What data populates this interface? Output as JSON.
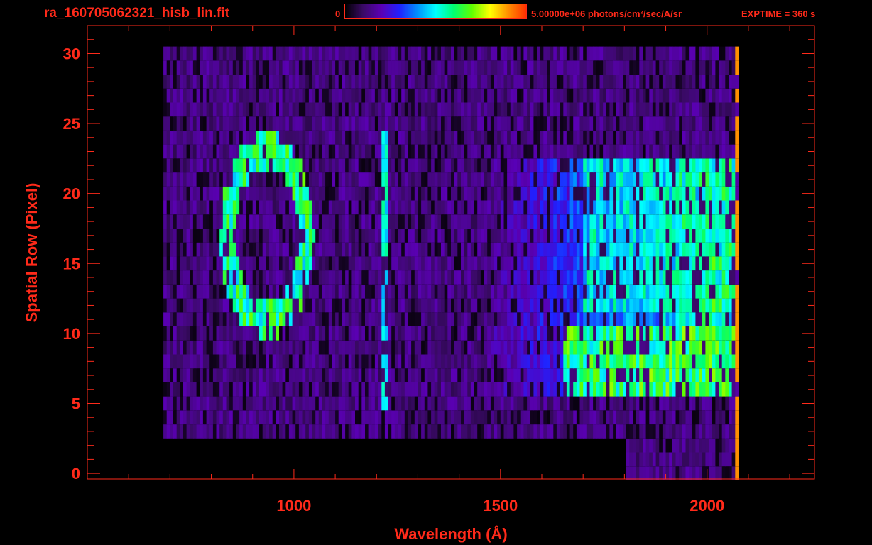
{
  "header": {
    "file_title": "ra_160705062321_hisb_lin.fit",
    "colorbar_min": "0",
    "colorbar_max": "5.00000e+06 photons/cm²/sec/A/sr",
    "exptime": "EXPTIME = 360 s"
  },
  "colors": {
    "text_and_axes": "#ff2a1a",
    "background": "#000000",
    "colormap": [
      "#000000",
      "#3a0a66",
      "#5a00b4",
      "#2020ff",
      "#0090ff",
      "#00ffff",
      "#00ff70",
      "#60ff00",
      "#ffff00",
      "#ff9000",
      "#ff3000"
    ]
  },
  "chart_data": {
    "type": "heatmap",
    "title": "ra_160705062321_hisb_lin.fit",
    "xlabel": "Wavelength (Å)",
    "ylabel": "Spatial Row (Pixel)",
    "xlim": [
      500,
      2260
    ],
    "ylim": [
      -0.4,
      32
    ],
    "xticks": [
      1000,
      1500,
      2000
    ],
    "yticks": [
      0,
      5,
      10,
      15,
      20,
      25,
      30
    ],
    "grid": false,
    "colorbar": {
      "min": 0,
      "max": 5000000,
      "units": "photons/cm²/sec/A/sr"
    },
    "rows": [
      0,
      30
    ],
    "data_extent_wavelength": [
      680,
      2075
    ],
    "features": [
      {
        "name": "bright band",
        "rows": [
          6,
          10
        ],
        "wavelength": [
          1650,
          2060
        ],
        "level": 0.62
      },
      {
        "name": "bright band",
        "rows": [
          12,
          22
        ],
        "wavelength": [
          1700,
          2060
        ],
        "level": 0.5
      },
      {
        "name": "vertical line",
        "wavelength": 1216,
        "rows": [
          5,
          24
        ],
        "level": 0.5
      },
      {
        "name": "ring",
        "center_wavelength": 930,
        "center_row": 17,
        "level": 0.55
      }
    ]
  }
}
